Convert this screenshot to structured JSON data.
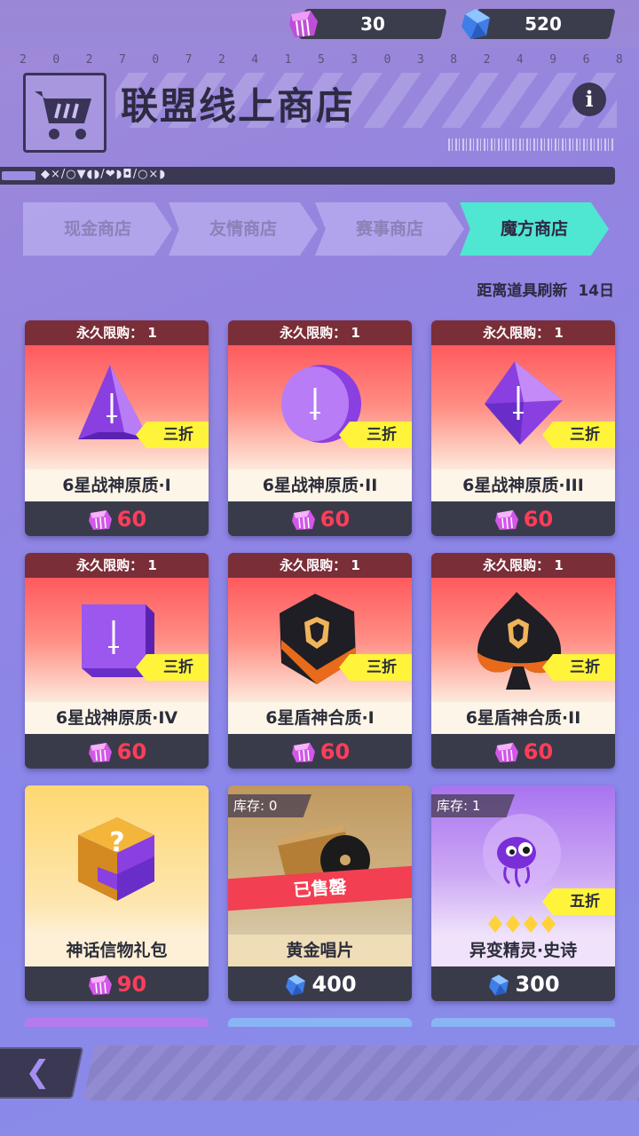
{
  "currency": {
    "gems": "30",
    "crystals": "520"
  },
  "header": {
    "serial_digits": [
      "2",
      "0",
      "2",
      "7",
      "0",
      "7",
      "2",
      "4",
      "1",
      "5",
      "3",
      "0",
      "3",
      "8",
      "2",
      "4",
      "9",
      "6",
      "8"
    ],
    "title": "联盟线上商店",
    "info_label": "i",
    "symbol_strip": "◆×/○▼◖◗/❤◗◘/○×◗"
  },
  "tabs": [
    {
      "label": "现金商店",
      "active": false
    },
    {
      "label": "友情商店",
      "active": false
    },
    {
      "label": "赛事商店",
      "active": false
    },
    {
      "label": "魔方商店",
      "active": true
    }
  ],
  "refresh": {
    "label": "距离道具刷新",
    "value": "14日"
  },
  "items": [
    {
      "limit": "永久限购： 1",
      "discount": "三折",
      "name": "6星战神原质·I",
      "price": "60",
      "currency": "gem"
    },
    {
      "limit": "永久限购： 1",
      "discount": "三折",
      "name": "6星战神原质·II",
      "price": "60",
      "currency": "gem"
    },
    {
      "limit": "永久限购： 1",
      "discount": "三折",
      "name": "6星战神原质·III",
      "price": "60",
      "currency": "gem"
    },
    {
      "limit": "永久限购： 1",
      "discount": "三折",
      "name": "6星战神原质·IV",
      "price": "60",
      "currency": "gem"
    },
    {
      "limit": "永久限购： 1",
      "discount": "三折",
      "name": "6星盾神合质·I",
      "price": "60",
      "currency": "gem"
    },
    {
      "limit": "永久限购： 1",
      "discount": "三折",
      "name": "6星盾神合质·II",
      "price": "60",
      "currency": "gem"
    },
    {
      "name": "神话信物礼包",
      "price": "90",
      "currency": "gem"
    },
    {
      "stock": "库存: 0",
      "sold_out": "已售罄",
      "name": "黄金唱片",
      "price": "400",
      "currency": "crystal"
    },
    {
      "stock": "库存: 1",
      "discount": "五折",
      "name": "异变精灵·史诗",
      "price": "300",
      "currency": "crystal"
    }
  ],
  "colors": {
    "active_tab": "#4fe6d2",
    "price_red": "#ff3d5a",
    "discount_yellow": "#fff43a",
    "limit_bar": "#7a2e38"
  }
}
